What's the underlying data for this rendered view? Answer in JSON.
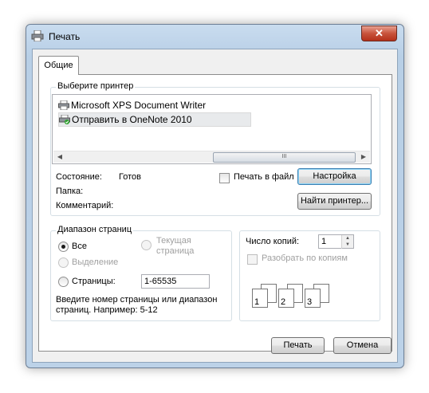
{
  "window": {
    "title": "Печать",
    "close_label": "✕"
  },
  "tabs": [
    {
      "label": "Общие"
    }
  ],
  "printer_group": {
    "legend": "Выберите принтер",
    "printers": [
      {
        "name": "Microsoft XPS Document Writer",
        "selected": false
      },
      {
        "name": "Отправить в OneNote 2010",
        "selected": true
      }
    ],
    "scroll_grip": "III",
    "status_label": "Состояние:",
    "status_value": "Готов",
    "folder_label": "Папка:",
    "comment_label": "Комментарий:",
    "print_to_file_label": "Печать в файл",
    "print_to_file_checked": false,
    "settings_button": "Настройка",
    "find_printer_button": "Найти принтер..."
  },
  "page_range": {
    "legend": "Диапазон страниц",
    "all_label": "Все",
    "current_page_label_1": "Текущая",
    "current_page_label_2": "страница",
    "selection_label": "Выделение",
    "pages_label": "Страницы:",
    "pages_value": "1-65535",
    "hint_line1": "Введите номер страницы или диапазон",
    "hint_line2": "страниц.  Например: 5-12",
    "selected_option": "all"
  },
  "copies": {
    "count_label": "Число копий:",
    "count_value": "1",
    "collate_label": "Разобрать по копиям",
    "collate_checked": false,
    "collate_pages": [
      "1",
      "1",
      "2",
      "2",
      "3",
      "3"
    ]
  },
  "footer": {
    "print_button": "Печать",
    "cancel_button": "Отмена"
  }
}
